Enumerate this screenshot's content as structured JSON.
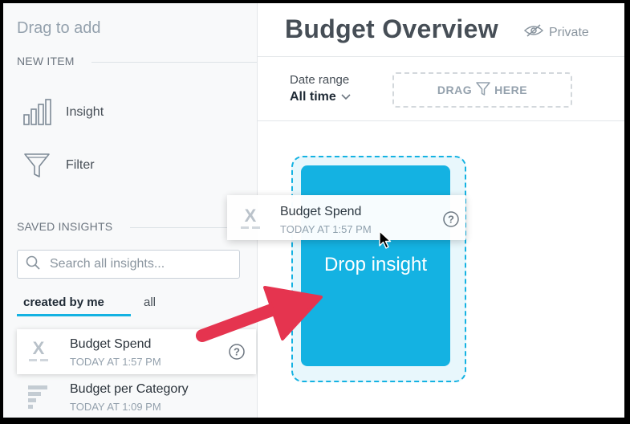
{
  "sidebar": {
    "drag_title": "Drag to add",
    "new_item_heading": "NEW ITEM",
    "new_items": [
      {
        "label": "Insight",
        "icon": "bar-chart-icon"
      },
      {
        "label": "Filter",
        "icon": "funnel-icon"
      }
    ],
    "saved_heading": "SAVED INSIGHTS",
    "search_placeholder": "Search all insights...",
    "tabs": [
      {
        "label": "created by me",
        "active": true
      },
      {
        "label": "all",
        "active": false
      }
    ],
    "insights": [
      {
        "name": "Budget Spend",
        "date": "TODAY AT 1:57 PM",
        "icon": "headline-x-icon"
      },
      {
        "name": "Budget per Category",
        "date": "TODAY AT 1:09 PM",
        "icon": "horizontal-bar-icon"
      }
    ]
  },
  "main": {
    "title": "Budget Overview",
    "visibility": "Private",
    "date_range_label": "Date range",
    "date_range_value": "All time",
    "drag_filter_left": "DRAG",
    "drag_filter_right": "HERE",
    "drop_text": "Drop insight"
  },
  "drag_card": {
    "name": "Budget Spend",
    "date": "TODAY AT 1:57 PM"
  },
  "colors": {
    "accent": "#14b2e2",
    "arrow": "#e5344f"
  }
}
